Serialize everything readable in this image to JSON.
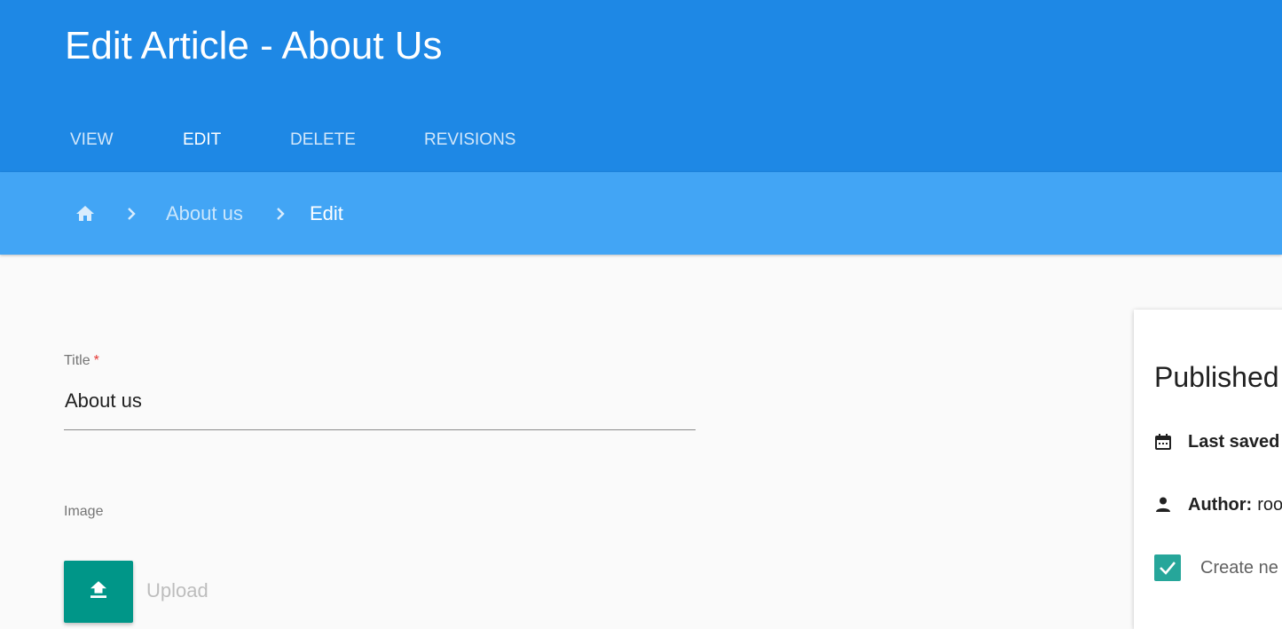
{
  "header": {
    "title": "Edit Article - About Us",
    "tabs": [
      {
        "label": "VIEW",
        "active": false
      },
      {
        "label": "EDIT",
        "active": true
      },
      {
        "label": "DELETE",
        "active": false
      },
      {
        "label": "REVISIONS",
        "active": false
      }
    ]
  },
  "breadcrumb": {
    "home_icon": "home-icon",
    "separator_icon": "chevron-right-icon",
    "items": [
      {
        "label": "About us"
      },
      {
        "label": "Edit"
      }
    ]
  },
  "form": {
    "title_label": "Title",
    "required_mark": "*",
    "title_value": "About us",
    "image_label": "Image",
    "upload_icon": "upload-icon",
    "upload_label": "Upload"
  },
  "side_card": {
    "title": "Published",
    "last_saved_label": "Last saved",
    "author_label": "Author:",
    "author_value": "roo",
    "create_revision_label": "Create ne",
    "create_revision_checked": true
  },
  "colors": {
    "header": "#1e88e5",
    "breadcrumb_bar": "#42a5f5",
    "accent": "#009688",
    "checkbox": "#26a69a",
    "required": "#e53935"
  }
}
